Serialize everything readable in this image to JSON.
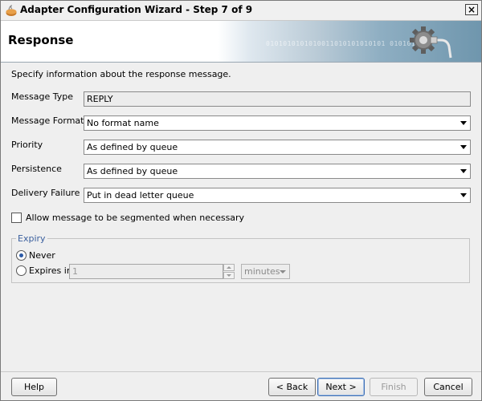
{
  "window": {
    "title": "Adapter Configuration Wizard - Step 7 of 9",
    "close_label": "×"
  },
  "banner": {
    "title": "Response",
    "binary_text": "0101010101010011010101010101 0101010101"
  },
  "form": {
    "intro": "Specify information about the response message.",
    "message_type": {
      "label": "Message Type",
      "value": "REPLY"
    },
    "message_format": {
      "label": "Message Format",
      "value": "No format name"
    },
    "priority": {
      "label": "Priority",
      "value": "As defined by queue"
    },
    "persistence": {
      "label": "Persistence",
      "value": "As defined by queue"
    },
    "delivery_failure": {
      "label": "Delivery Failure",
      "value": "Put in dead letter queue"
    },
    "segment_checkbox": {
      "label": "Allow message to be segmented when necessary",
      "checked": false
    }
  },
  "expiry": {
    "legend": "Expiry",
    "never_label": "Never",
    "expires_label": "Expires in",
    "selected": "never",
    "amount": "1",
    "units": "minutes"
  },
  "footer": {
    "help": "Help",
    "back": "< Back",
    "next": "Next >",
    "finish": "Finish",
    "cancel": "Cancel"
  },
  "colors": {
    "accent": "#2b5aa6",
    "legend": "#3a5f9e",
    "banner_blue": "#6f96ad"
  },
  "icons": [
    "app-icon",
    "close-icon",
    "gear-plug-icon",
    "dropdown-arrow-icon"
  ]
}
